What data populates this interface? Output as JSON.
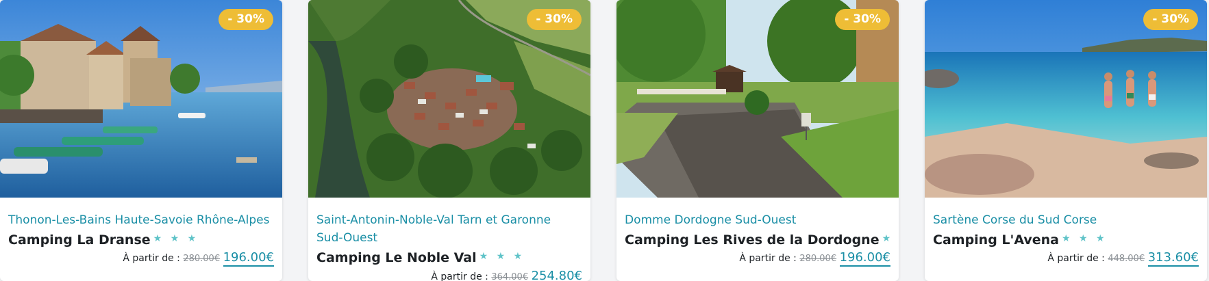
{
  "cards": [
    {
      "discount": "- 30%",
      "location": "Thonon-Les-Bains Haute-Savoie Rhône-Alpes",
      "name": "Camping La Dranse",
      "stars": "★ ★ ★",
      "price_prefix": "À partir de :",
      "old_price": "280.00€",
      "new_price": "196.00€",
      "image": "lakeside-castle-harbor-photo"
    },
    {
      "discount": "- 30%",
      "location": "Saint-Antonin-Noble-Val Tarn et Garonne Sud-Ouest",
      "name": "Camping Le Noble Val",
      "stars": "★ ★ ★",
      "price_prefix": "À partir de :",
      "old_price": "364.00€",
      "new_price": "254.80€",
      "image": "aerial-campsite-river-photo"
    },
    {
      "discount": "- 30%",
      "location": "Domme Dordogne Sud-Ouest",
      "name": "Camping Les Rives de la Dordogne",
      "stars": "★ ★ ★",
      "price_prefix": "À partir de :",
      "old_price": "280.00€",
      "new_price": "196.00€",
      "image": "campsite-path-trees-photo"
    },
    {
      "discount": "- 30%",
      "location": "Sartène Corse du Sud Corse",
      "name": "Camping L'Avena",
      "stars": "★ ★ ★",
      "price_prefix": "À partir de :",
      "old_price": "448.00€",
      "new_price": "313.60€",
      "image": "turquoise-beach-bathers-photo"
    }
  ],
  "colors": {
    "accent": "#1b8fa6",
    "badge": "#eebd36",
    "stars": "#5fc3c8"
  }
}
